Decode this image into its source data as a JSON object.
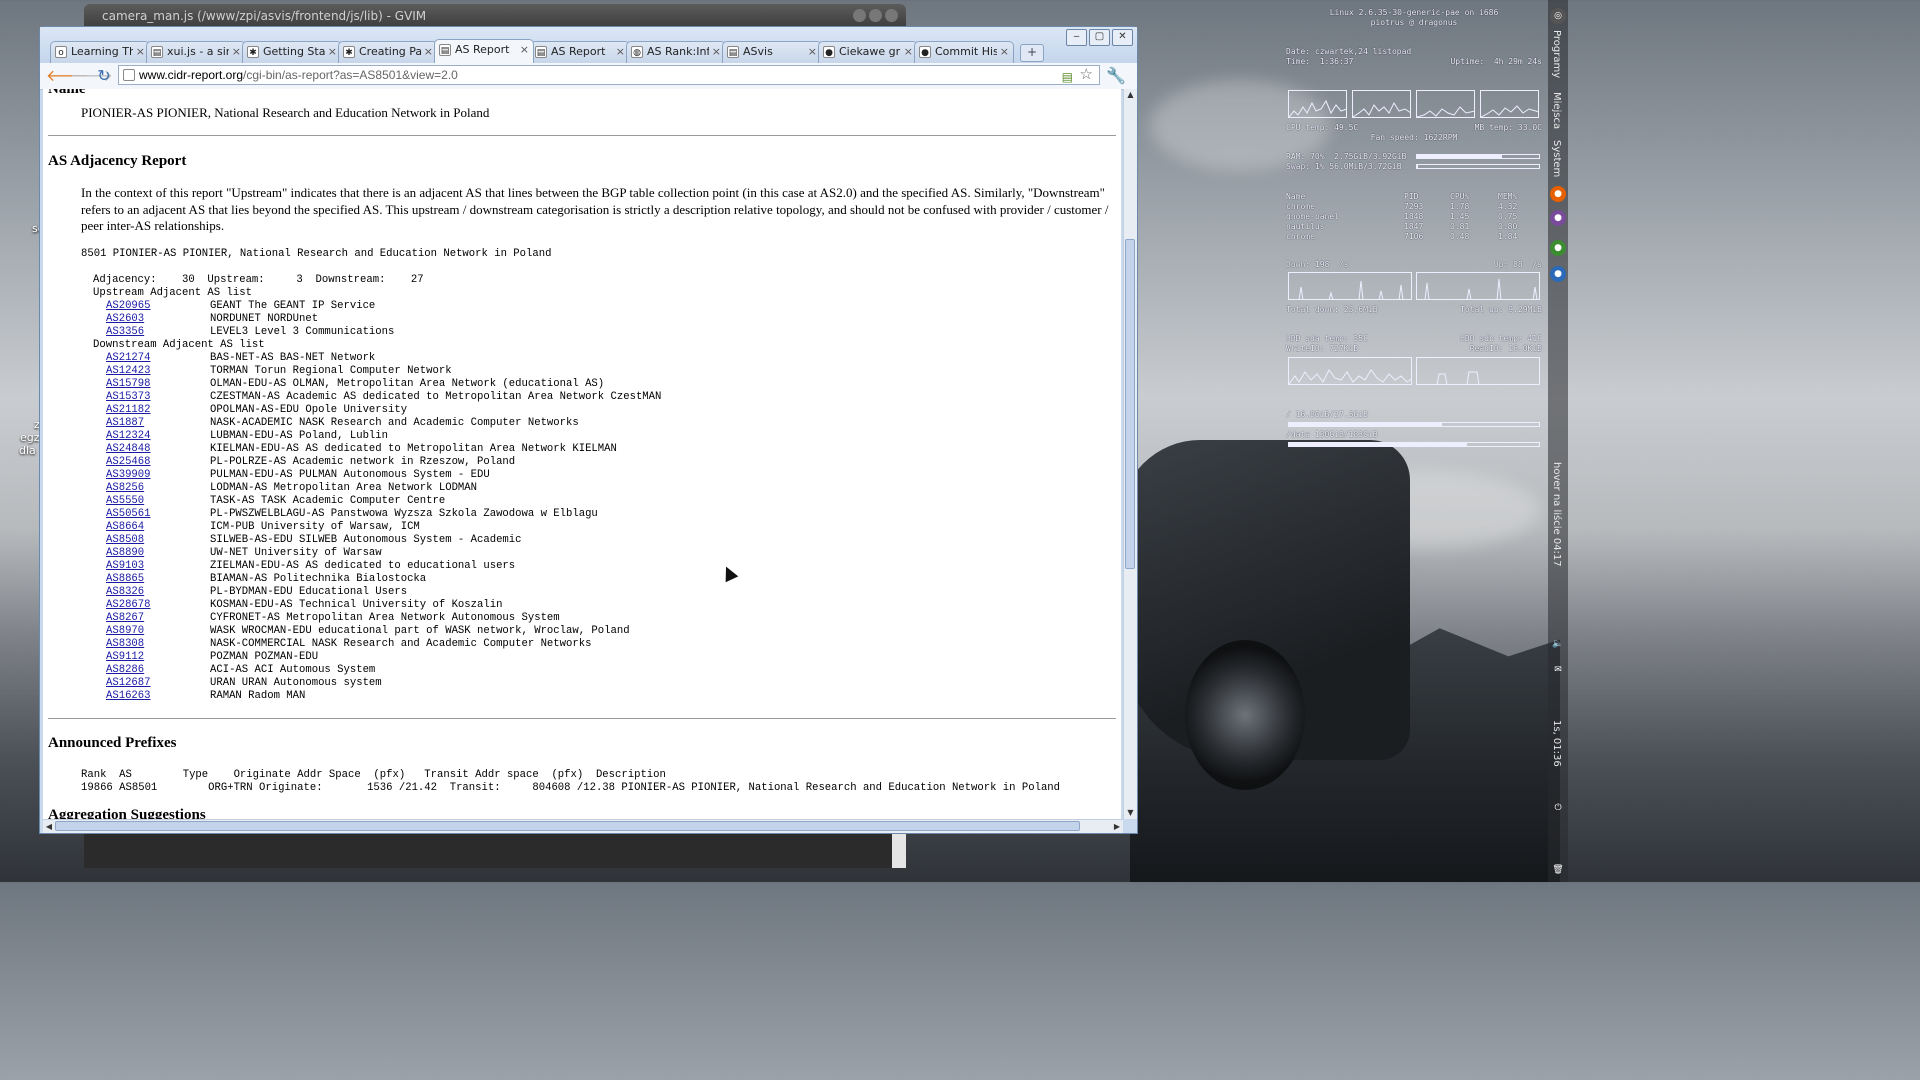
{
  "gvim": {
    "title": "camera_man.js (/www/zpi/asvis/frontend/js/lib) - GVIM"
  },
  "desktop": {
    "labels": [
      "z",
      "egz",
      "dla",
      "sc"
    ]
  },
  "browser": {
    "tabs": [
      {
        "label": "Learning Thr",
        "icon": "o"
      },
      {
        "label": "xui.js - a simp",
        "icon": "doc"
      },
      {
        "label": "Getting Start",
        "icon": "gear"
      },
      {
        "label": "Creating Part",
        "icon": "gear"
      },
      {
        "label": "AS Report",
        "icon": "doc",
        "active": true
      },
      {
        "label": "AS Report",
        "icon": "doc"
      },
      {
        "label": "AS Rank:Info",
        "icon": "globe"
      },
      {
        "label": "ASvis",
        "icon": "doc"
      },
      {
        "label": "Ciekawe graf",
        "icon": "github"
      },
      {
        "label": "Commit Histo",
        "icon": "github"
      }
    ],
    "url_host": "www.cidr-report.org",
    "url_path": "/cgi-bin/as-report?as=AS8501&view=2.0"
  },
  "page": {
    "name_heading": "Name",
    "name_text": "PIONIER-AS PIONIER, National Research and Education Network in Poland",
    "adjacency_heading": "AS Adjacency Report",
    "adjacency_intro": "In the context of this report \"Upstream\" indicates that there is an adjacent AS that lines between the BGP table collection point (in this case at AS2.0) and the specified AS. Similarly, \"Downstream\" refers to an adjacent AS that lies beyond the specified AS. This upstream / downstream categorisation is strictly a description relative topology, and should not be confused with provider / customer / peer inter-AS relationships.",
    "as_line": "8501 PIONIER-AS PIONIER, National Research and Education Network in Poland",
    "counts_line": "Adjacency:    30  Upstream:     3  Downstream:    27",
    "upstream_heading": "Upstream Adjacent AS list",
    "upstream": [
      {
        "as": "AS20965",
        "desc": "GEANT The GEANT IP Service"
      },
      {
        "as": "AS2603",
        "desc": "NORDUNET NORDUnet"
      },
      {
        "as": "AS3356",
        "desc": "LEVEL3 Level 3 Communications"
      }
    ],
    "downstream_heading": "Downstream Adjacent AS list",
    "downstream": [
      {
        "as": "AS21274",
        "desc": "BAS-NET-AS BAS-NET Network"
      },
      {
        "as": "AS12423",
        "desc": "TORMAN Torun Regional Computer Network"
      },
      {
        "as": "AS15798",
        "desc": "OLMAN-EDU-AS OLMAN, Metropolitan Area Network (educational AS)"
      },
      {
        "as": "AS15373",
        "desc": "CZESTMAN-AS Academic AS dedicated to Metropolitan Area Network CzestMAN"
      },
      {
        "as": "AS21182",
        "desc": "OPOLMAN-AS-EDU Opole University"
      },
      {
        "as": "AS1887",
        "desc": "NASK-ACADEMIC NASK Research and Academic Computer Networks"
      },
      {
        "as": "AS12324",
        "desc": "LUBMAN-EDU-AS Poland, Lublin"
      },
      {
        "as": "AS24848",
        "desc": "KIELMAN-EDU-AS AS dedicated to Metropolitan Area Network KIELMAN"
      },
      {
        "as": "AS25468",
        "desc": "PL-POLRZE-AS Academic network in Rzeszow, Poland"
      },
      {
        "as": "AS39909",
        "desc": "PULMAN-EDU-AS PULMAN Autonomous System - EDU"
      },
      {
        "as": "AS8256",
        "desc": "LODMAN-AS Metropolitan Area Network LODMAN"
      },
      {
        "as": "AS5550",
        "desc": "TASK-AS TASK Academic Computer Centre"
      },
      {
        "as": "AS50561",
        "desc": "PL-PWSZWELBLAGU-AS Panstwowa Wyzsza Szkola Zawodowa w Elblagu"
      },
      {
        "as": "AS8664",
        "desc": "ICM-PUB University of Warsaw, ICM"
      },
      {
        "as": "AS8508",
        "desc": "SILWEB-AS-EDU SILWEB Autonomous System - Academic"
      },
      {
        "as": "AS8890",
        "desc": "UW-NET University of Warsaw"
      },
      {
        "as": "AS9103",
        "desc": "ZIELMAN-EDU-AS AS dedicated to educational users"
      },
      {
        "as": "AS8865",
        "desc": "BIAMAN-AS Politechnika Bialostocka"
      },
      {
        "as": "AS8326",
        "desc": "PL-BYDMAN-EDU Educational Users"
      },
      {
        "as": "AS28678",
        "desc": "KOSMAN-EDU-AS Technical University of Koszalin"
      },
      {
        "as": "AS8267",
        "desc": "CYFRONET-AS Metropolitan Area Network Autonomous System"
      },
      {
        "as": "AS8970",
        "desc": "WASK WROCMAN-EDU educational part of WASK network, Wroclaw, Poland"
      },
      {
        "as": "AS8308",
        "desc": "NASK-COMMERCIAL NASK Research and Academic Computer Networks"
      },
      {
        "as": "AS9112",
        "desc": "POZMAN POZMAN-EDU"
      },
      {
        "as": "AS8286",
        "desc": "ACI-AS ACI Automous System"
      },
      {
        "as": "AS12687",
        "desc": "URAN URAN Autonomous system"
      },
      {
        "as": "AS16263",
        "desc": "RAMAN Radom MAN"
      }
    ],
    "prefixes_heading": "Announced Prefixes",
    "prefixes_header": "Rank  AS        Type    Originate Addr Space  (pfx)   Transit Addr space  (pfx)  Description",
    "prefixes_row": "19866 AS8501        ORG+TRN Originate:       1536 /21.42  Transit:     804608 /12.38 PIONIER-AS PIONIER, National Research and Education Network in Poland",
    "next_heading": "Aggregation Suggestions"
  },
  "conky": {
    "header1": "Linux 2.6.35-30-generic-pae on i686",
    "header2": "piotrus @ dragonus",
    "date": "Date: czwartek,24 listopad",
    "time": "Time:  1:36:37",
    "uptime": "Uptime:  4h 29m 24s",
    "cpu_temp": "CPU temp: 49.5C",
    "mb_temp": "MB temp: 33.0C",
    "fan": "Fan speed: 1622RPM",
    "ram": "RAM: 70%  2.75GiB/3.92GiB",
    "ram_pct": 0.7,
    "swap": "Swap: 1% 56.0MiB/3.72GiB",
    "swap_pct": 0.01,
    "proc_header": [
      "Name",
      "PID",
      "CPU%",
      "MEM%"
    ],
    "procs": [
      [
        "chrome",
        "7293",
        "1.78",
        "4.32"
      ],
      [
        "gnome-panel",
        "1848",
        "1.45",
        "0.75"
      ],
      [
        "nautilus",
        "1847",
        "0.81",
        "0.80"
      ],
      [
        "chrome",
        "7106",
        "0.48",
        "1.84"
      ]
    ],
    "down": "Down: 198  /s",
    "up": "Up: 88  /s",
    "total_down": "Total down: 23.6MiB",
    "total_up": "Total up: 9.29MiB",
    "sda_temp": "HDD sda temp: 35C",
    "sdb_temp": "HDD sdb temp: 41C",
    "write_io": "WriteIO: 727KiB",
    "read_io": "ReadIO: 16.0KiB",
    "root_fs": "/ 16.8GiB/27.5GiB",
    "root_pct": 0.61,
    "data_fs": "/data 130GiB/183GiB",
    "data_pct": 0.71
  },
  "panel_right": {
    "menus": [
      "Programy",
      "Miejsca",
      "System"
    ],
    "clock": "hover na liście 04:17",
    "bottom": "1s, 01:36"
  }
}
